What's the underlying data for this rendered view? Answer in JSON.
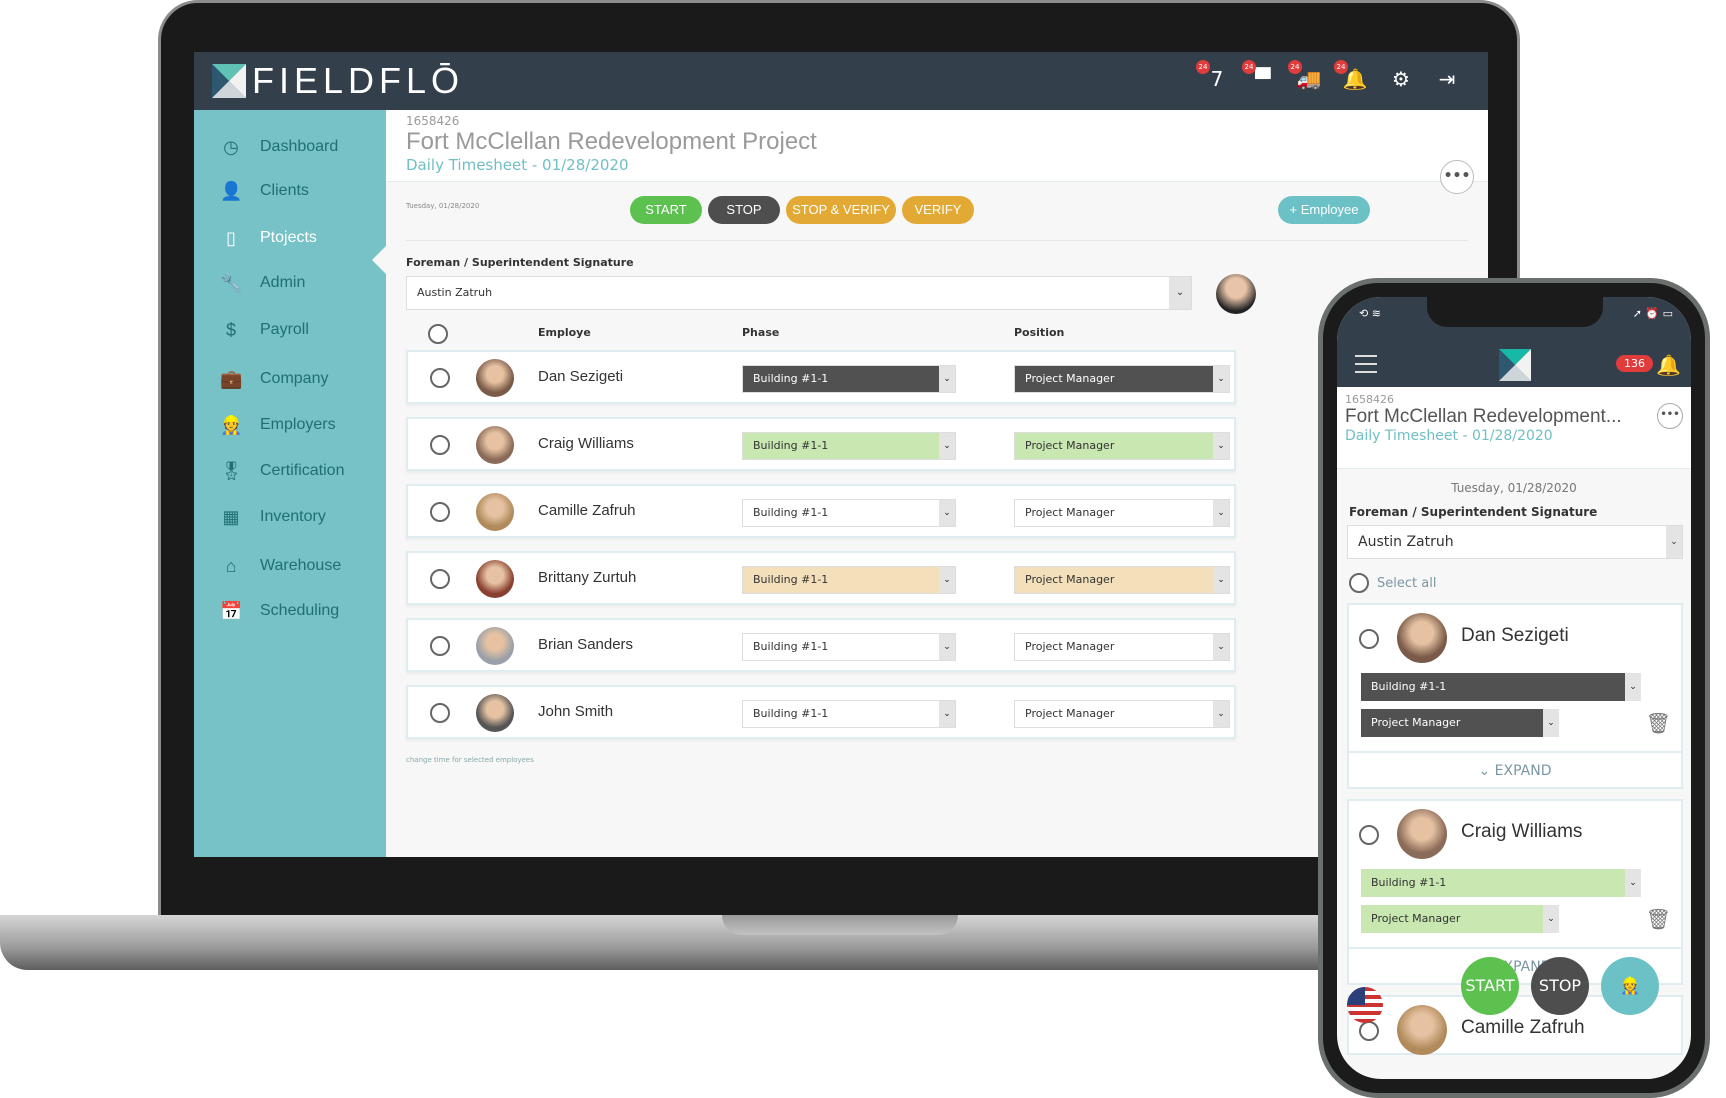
{
  "app": {
    "brand": "FIELDFLŌ"
  },
  "topbar": {
    "icons": [
      {
        "name": "calendar-icon",
        "badge": "24",
        "glyph": "7"
      },
      {
        "name": "messages-icon",
        "badge": "24",
        "glyph": "▀"
      },
      {
        "name": "truck-icon",
        "badge": "24",
        "glyph": "🚚"
      },
      {
        "name": "bell-icon",
        "badge": "24",
        "glyph": "🔔"
      },
      {
        "name": "gear-icon",
        "badge": "",
        "glyph": "⚙"
      },
      {
        "name": "logout-icon",
        "badge": "",
        "glyph": "⇥"
      }
    ]
  },
  "sidebar": {
    "items": [
      {
        "label": "Dashboard",
        "icon": "◷"
      },
      {
        "label": "Clients",
        "icon": "👤"
      },
      {
        "label": "Ptojects",
        "icon": "▯"
      },
      {
        "label": "Admin",
        "icon": "🔧"
      },
      {
        "label": "Payroll",
        "icon": "$"
      },
      {
        "label": "Company",
        "icon": "💼"
      },
      {
        "label": "Employers",
        "icon": "👷"
      },
      {
        "label": "Certification",
        "icon": "🎖"
      },
      {
        "label": "Inventory",
        "icon": "▦"
      },
      {
        "label": "Warehouse",
        "icon": "⌂"
      },
      {
        "label": "Scheduling",
        "icon": "📅"
      }
    ],
    "active": "Ptojects"
  },
  "header": {
    "project_id": "1658426",
    "title": "Fort McClellan Redevelopment Project",
    "subtitle": "Daily Timesheet - 01/28/2020",
    "more": "•••"
  },
  "toolbar": {
    "date": "Tuesday, 01/28/2020",
    "start": "START",
    "stop": "STOP",
    "stop_verify": "STOP & VERIFY",
    "verify": "VERIFY",
    "add_employee": "+ Employee"
  },
  "colors": {
    "start": "#5cc14f",
    "stop": "#4e4e4e",
    "verify": "#e2aa35",
    "add": "#6bc1c6",
    "sidebar": "#76c2c6",
    "topbar": "#343f4c"
  },
  "signature": {
    "label": "Foreman / Superintendent Signature",
    "value": "Austin Zatruh"
  },
  "table": {
    "headers": {
      "employee": "Employe",
      "phase": "Phase",
      "position": "Position"
    },
    "rows": [
      {
        "name": "Dan Sezigeti",
        "phase": "Building #1-1",
        "position": "Project Manager",
        "state": "dark"
      },
      {
        "name": "Craig Williams",
        "phase": "Building #1-1",
        "position": "Project Manager",
        "state": "green"
      },
      {
        "name": "Camille Zafruh",
        "phase": "Building #1-1",
        "position": "Project Manager",
        "state": "white"
      },
      {
        "name": "Brittany Zurtuh",
        "phase": "Building #1-1",
        "position": "Project Manager",
        "state": "tan"
      },
      {
        "name": "Brian Sanders",
        "phase": "Building #1-1",
        "position": "Project Manager",
        "state": "white"
      },
      {
        "name": "John Smith",
        "phase": "Building #1-1",
        "position": "Project Manager",
        "state": "white"
      }
    ],
    "footnote": "change time for selected employees"
  },
  "mobile": {
    "badge": "136",
    "project_id": "1658426",
    "title": "Fort McClellan Redevelopment...",
    "subtitle": "Daily Timesheet - 01/28/2020",
    "date": "Tuesday, 01/28/2020",
    "sig_label": "Foreman / Superintendent Signature",
    "sig_value": "Austin Zatruh",
    "select_all": "Select all",
    "cards": [
      {
        "name": "Dan Sezigeti",
        "phase": "Building #1-1",
        "position": "Project Manager",
        "expand": "EXPAND"
      },
      {
        "name": "Craig Williams",
        "phase": "Building #1-1",
        "position": "Project Manager",
        "expand": "EXPAND"
      },
      {
        "name": "Camille Zafruh"
      }
    ],
    "fab_start": "START",
    "fab_stop": "STOP"
  }
}
